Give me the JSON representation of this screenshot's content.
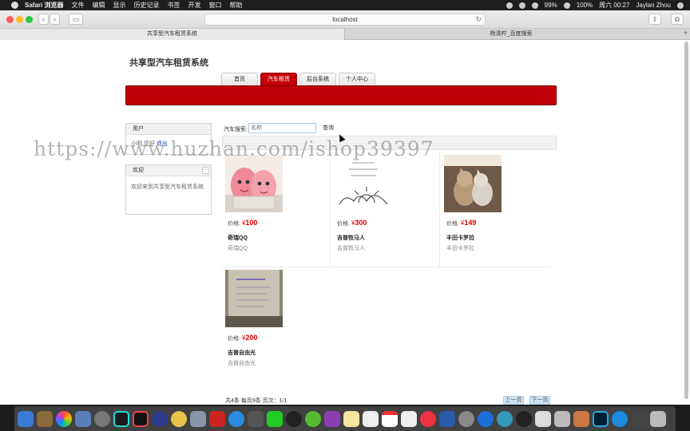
{
  "menubar": {
    "app_name": "Safari 浏览器",
    "items": [
      "文件",
      "编辑",
      "显示",
      "历史记录",
      "书签",
      "开发",
      "窗口",
      "帮助"
    ],
    "battery": "99%",
    "battery2": "100%",
    "datetime": "周六 00:27",
    "user": "Jaylan Zhou"
  },
  "browser": {
    "url": "localhost",
    "tabs": [
      {
        "label": "共享型汽车租赁系统"
      },
      {
        "label": "杨清柠_百度搜索"
      }
    ]
  },
  "page": {
    "site_title": "共享型汽车租赁系统",
    "nav": [
      {
        "label": "首页"
      },
      {
        "label": "汽车租赁"
      },
      {
        "label": "后台系统"
      },
      {
        "label": "个人中心"
      }
    ],
    "user_box": {
      "header": "用户",
      "greeting": "小明,您好",
      "logout": "退出"
    },
    "welcome_box": {
      "header": "欢迎",
      "text": "欢迎来到共享型汽车租赁系统"
    },
    "search": {
      "label": "汽车搜索:",
      "placeholder": "名称",
      "button": "查询"
    },
    "price_label": "价格:",
    "currency": "¥",
    "products": [
      {
        "price": "100",
        "name": "奇瑞QQ",
        "desc": "奇瑞QQ",
        "image": "eggs-image"
      },
      {
        "price": "300",
        "name": "吉普牧马人",
        "desc": "吉普牧马人",
        "image": "sketch-image"
      },
      {
        "price": "149",
        "name": "丰田卡罗拉",
        "desc": "丰田卡罗拉",
        "image": "cats-image"
      },
      {
        "price": "200",
        "name": "吉普自由光",
        "desc": "吉普自由光",
        "image": "phone-image"
      }
    ],
    "pager": {
      "info": "共4条 每页9条 页次：1/1",
      "prev": "上一页",
      "next": "下一页"
    },
    "watermark": "https://www.huzhan.com/ishop39397"
  },
  "colors": {
    "brand_red": "#c00009",
    "price_red": "#dd0000"
  }
}
